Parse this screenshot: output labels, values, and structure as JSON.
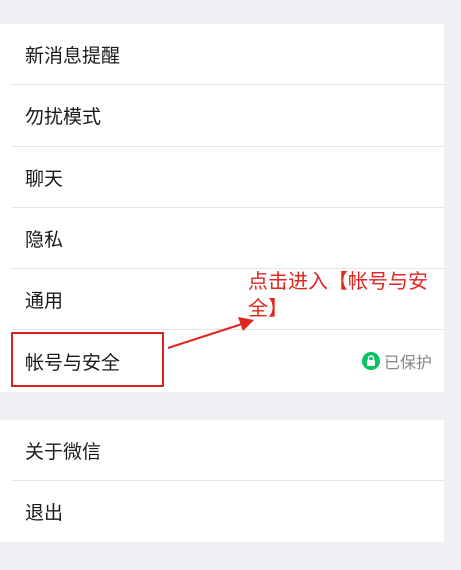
{
  "settings": {
    "group1": [
      {
        "label": "新消息提醒"
      },
      {
        "label": "勿扰模式"
      },
      {
        "label": "聊天"
      },
      {
        "label": "隐私"
      },
      {
        "label": "通用"
      },
      {
        "label": "帐号与安全",
        "status": "已保护"
      }
    ],
    "group2": [
      {
        "label": "关于微信"
      },
      {
        "label": "退出"
      }
    ]
  },
  "annotation": {
    "text": "点击进入【帐号与安全】",
    "color": "#e0251f"
  },
  "colors": {
    "background": "#efeff4",
    "accent_green": "#07c160",
    "highlight_red": "#d9231f"
  }
}
